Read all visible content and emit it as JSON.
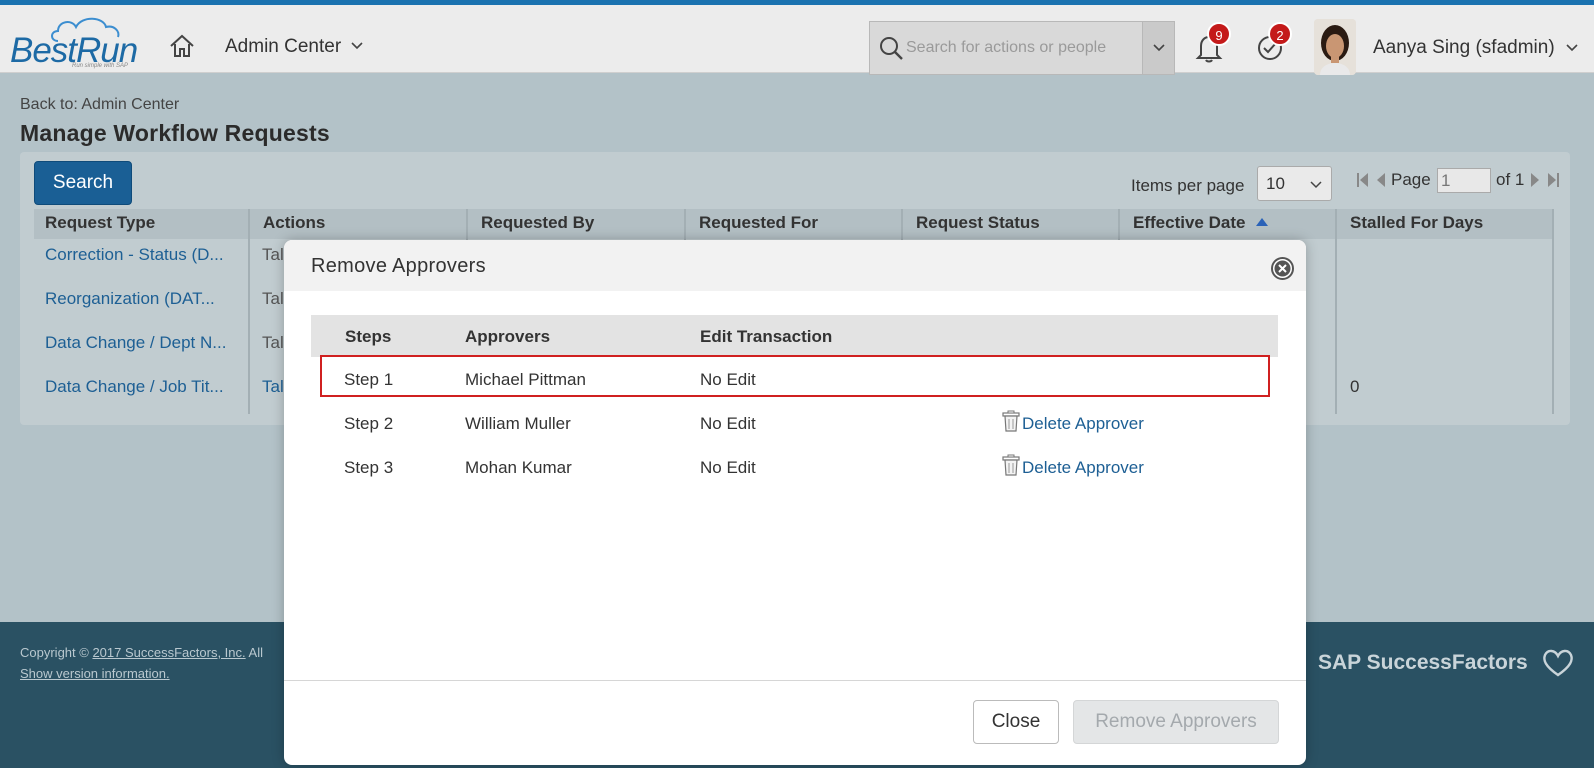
{
  "header": {
    "logo_text": "BestRun",
    "logo_tagline": "Run simple with SAP",
    "admin_center_label": "Admin Center",
    "search_placeholder": "Search for actions or people",
    "notifications_count": "9",
    "todo_count": "2",
    "user_name": "Aanya Sing (sfadmin)"
  },
  "page": {
    "back_link": "Back to: Admin Center",
    "title": "Manage Workflow Requests",
    "search_button": "Search",
    "items_per_page_label": "Items per page",
    "items_per_page_value": "10",
    "page_label": "Page",
    "page_value": "1",
    "page_of": "of 1"
  },
  "grid": {
    "columns": [
      "Request Type",
      "Actions",
      "Requested By",
      "Requested For",
      "Request Status",
      "Effective Date",
      "Stalled For Days"
    ],
    "rows": [
      {
        "request_type": "Correction - Status (D...",
        "action": "Tal",
        "stalled": ""
      },
      {
        "request_type": "Reorganization (DAT...",
        "action": "Tal",
        "stalled": ""
      },
      {
        "request_type": "Data Change / Dept N...",
        "action": "Tal",
        "stalled": ""
      },
      {
        "request_type": "Data Change / Job Tit...",
        "action": "Tal",
        "stalled": "0"
      }
    ]
  },
  "footer": {
    "copyright_prefix": "Copyright ©",
    "copyright_link": "2017 SuccessFactors, Inc.",
    "copyright_suffix": "All",
    "version_link": "Show version information.",
    "brand": "SAP SuccessFactors"
  },
  "modal": {
    "title": "Remove Approvers",
    "columns": {
      "steps": "Steps",
      "approvers": "Approvers",
      "edit": "Edit Transaction"
    },
    "rows": [
      {
        "step": "Step 1",
        "approver": "Michael Pittman",
        "edit": "No Edit",
        "delete": ""
      },
      {
        "step": "Step 2",
        "approver": "William Muller",
        "edit": "No Edit",
        "delete": "Delete Approver"
      },
      {
        "step": "Step 3",
        "approver": "Mohan Kumar",
        "edit": "No Edit",
        "delete": "Delete Approver"
      }
    ],
    "close_button": "Close",
    "remove_button": "Remove Approvers"
  },
  "colors": {
    "accent": "#1a72b0",
    "link": "#1d5f94",
    "highlight_border": "#d02020",
    "badge": "#c41a1a",
    "footer": "#2a5163"
  }
}
